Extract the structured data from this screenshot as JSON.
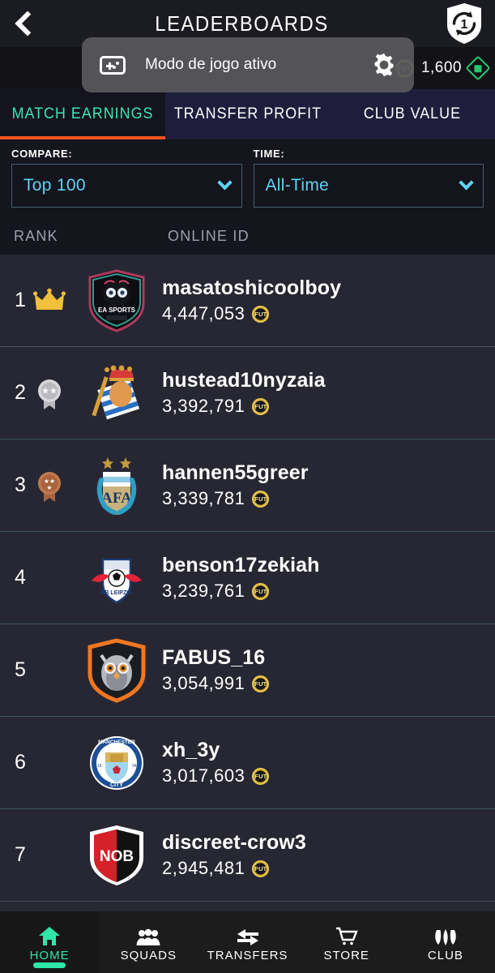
{
  "header": {
    "back_icon": "chevron-left-icon",
    "title": "LEADERBOARDS",
    "squad_update_icon": "squad-update-shield-icon",
    "squad_update_count": "1"
  },
  "currency": {
    "coin_icon": "fut-coin-icon",
    "coin_label": "FUT",
    "coin_amount": "1,600",
    "points_icon": "fifa-points-diamond-icon"
  },
  "toast": {
    "icon": "gamepad-icon",
    "text": "Modo de jogo ativo",
    "settings_icon": "gear-icon"
  },
  "tabs": [
    {
      "label": "MATCH EARNINGS",
      "active": true
    },
    {
      "label": "TRANSFER PROFIT",
      "active": false
    },
    {
      "label": "CLUB VALUE",
      "active": false
    }
  ],
  "filters": {
    "compare": {
      "label": "COMPARE:",
      "value": "Top 100",
      "chevron_icon": "chevron-down-icon"
    },
    "time": {
      "label": "TIME:",
      "value": "All-Time",
      "chevron_icon": "chevron-down-icon"
    }
  },
  "columns": {
    "rank": "RANK",
    "online_id": "ONLINE ID"
  },
  "rows": [
    {
      "rank": "1",
      "medal": "gold-crown-icon",
      "crest": "ea-sports-skull-crest",
      "name": "masatoshicoolboy",
      "coins": "4,447,053",
      "coin_label": "FUT"
    },
    {
      "rank": "2",
      "medal": "silver-medal-icon",
      "crest": "real-sociedad-crest",
      "name": "hustead10nyzaia",
      "coins": "3,392,791",
      "coin_label": "FUT"
    },
    {
      "rank": "3",
      "medal": "bronze-medal-icon",
      "crest": "argentina-afa-crest",
      "name": "hannen55greer",
      "coins": "3,339,781",
      "coin_label": "FUT"
    },
    {
      "rank": "4",
      "medal": "",
      "crest": "rb-leipzig-crest",
      "name": "benson17zekiah",
      "coins": "3,239,761",
      "coin_label": "FUT"
    },
    {
      "rank": "5",
      "medal": "",
      "crest": "owl-orange-crest",
      "name": "FABUS_16",
      "coins": "3,054,991",
      "coin_label": "FUT"
    },
    {
      "rank": "6",
      "medal": "",
      "crest": "manchester-city-crest",
      "name": "xh_3y",
      "coins": "3,017,603",
      "coin_label": "FUT"
    },
    {
      "rank": "7",
      "medal": "",
      "crest": "newells-old-boys-crest",
      "name": "discreet-crow3",
      "coins": "2,945,481",
      "coin_label": "FUT"
    }
  ],
  "bottom_nav": [
    {
      "label": "HOME",
      "icon": "home-icon",
      "active": true
    },
    {
      "label": "SQUADS",
      "icon": "squads-people-icon",
      "active": false
    },
    {
      "label": "TRANSFERS",
      "icon": "transfers-arrows-icon",
      "active": false
    },
    {
      "label": "STORE",
      "icon": "shopping-cart-icon",
      "active": false
    },
    {
      "label": "CLUB",
      "icon": "club-shield-icon",
      "active": false
    }
  ],
  "colors": {
    "accent_teal": "#3ce5b0",
    "accent_orange": "#f2551f",
    "link_blue": "#5fd2f5",
    "tab_bg": "#1e1e3c",
    "row_bg": "#272733"
  }
}
